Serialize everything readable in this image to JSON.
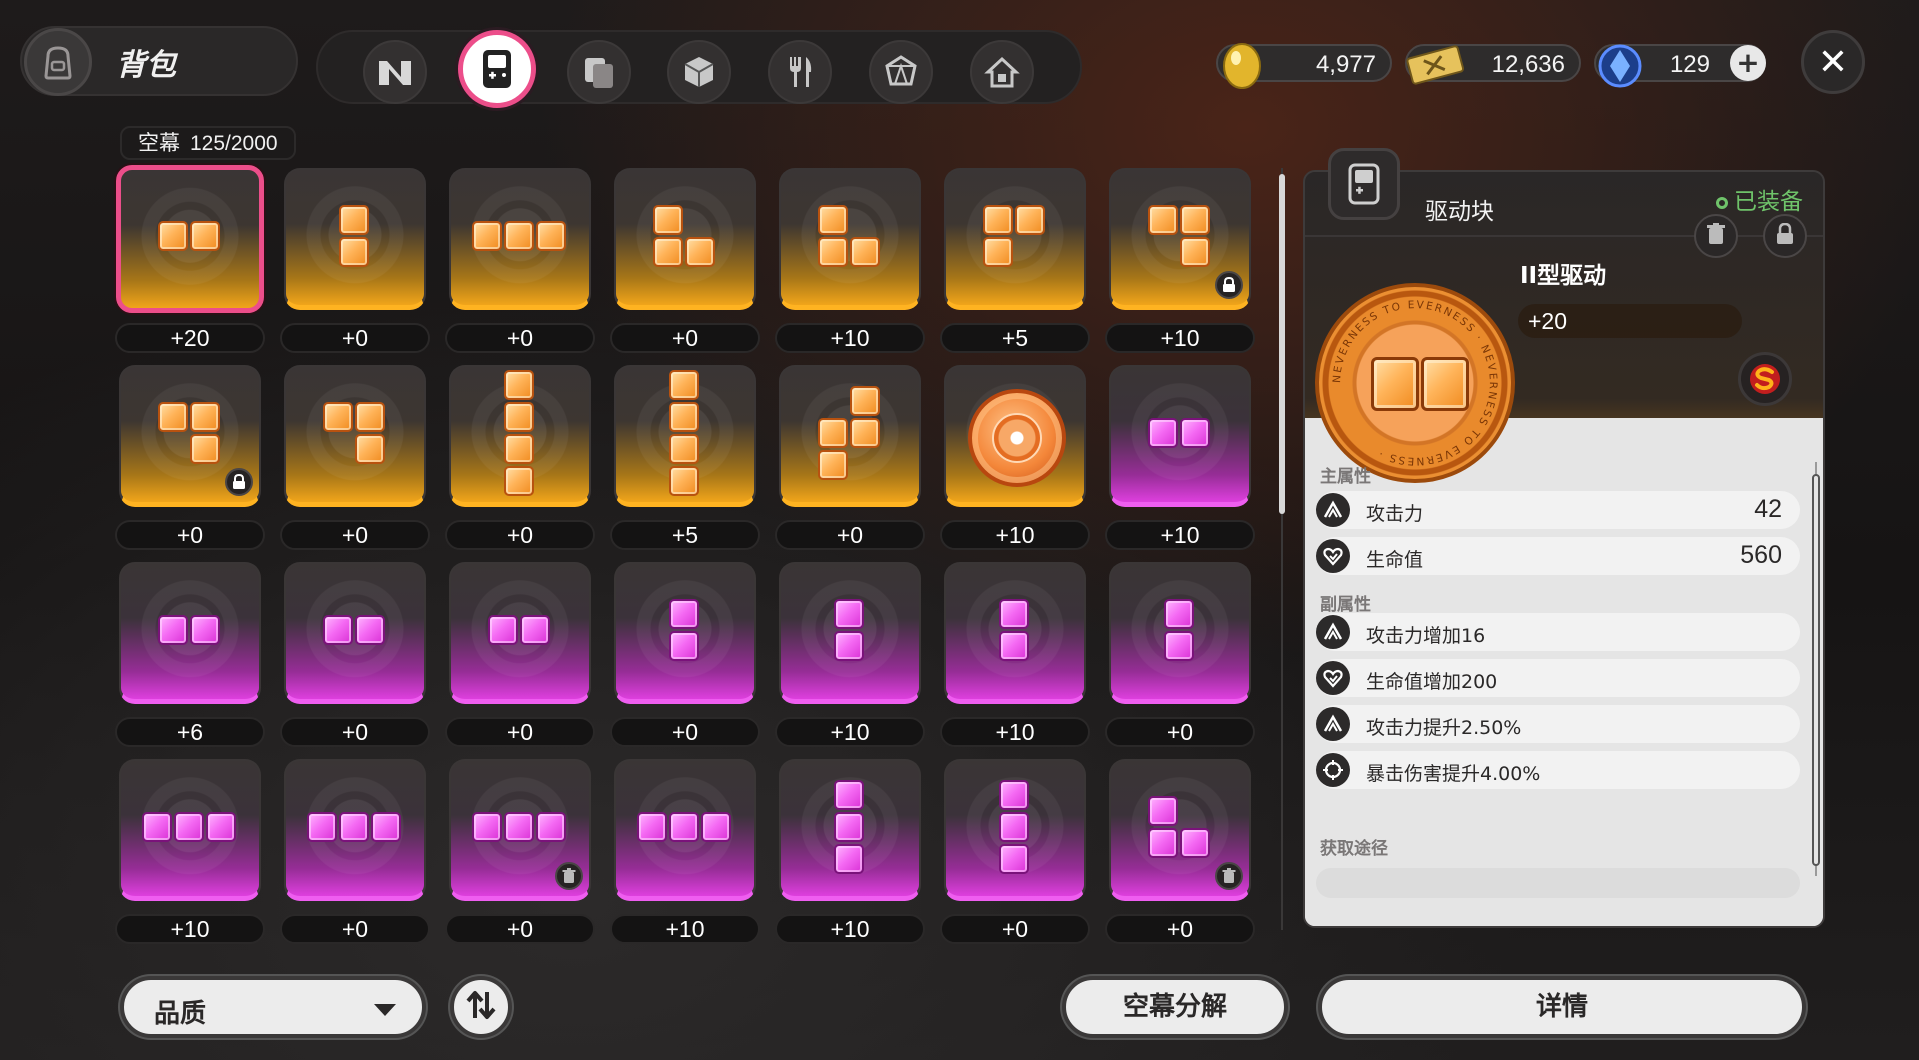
{
  "header": {
    "title": "背包",
    "tabs": [
      {
        "icon": "n-logo-icon",
        "active": false
      },
      {
        "icon": "handheld-console-icon",
        "active": true
      },
      {
        "icon": "stacked-cards-icon",
        "active": false
      },
      {
        "icon": "cube-icon",
        "active": false
      },
      {
        "icon": "fork-knife-icon",
        "active": false
      },
      {
        "icon": "crystal-box-icon",
        "active": false
      },
      {
        "icon": "house-icon",
        "active": false
      }
    ],
    "currencies": [
      {
        "icon": "gold-egg-icon",
        "value": "4,977"
      },
      {
        "icon": "ticket-icon",
        "value": "12,636"
      },
      {
        "icon": "blue-crystal-icon",
        "value": "129"
      }
    ],
    "add_label": "+",
    "close_label": "✕"
  },
  "inventory": {
    "label": "空幕",
    "count": "125/2000",
    "items": [
      {
        "color": "orange",
        "shape": "h2",
        "level": "+20",
        "selected": true,
        "badge": ""
      },
      {
        "color": "orange",
        "shape": "v2",
        "level": "+0",
        "badge": ""
      },
      {
        "color": "orange",
        "shape": "h3",
        "level": "+0",
        "badge": ""
      },
      {
        "color": "orange",
        "shape": "L",
        "level": "+0",
        "badge": ""
      },
      {
        "color": "orange",
        "shape": "L",
        "level": "+10",
        "badge": ""
      },
      {
        "color": "orange",
        "shape": "Gamma",
        "level": "+5",
        "badge": ""
      },
      {
        "color": "orange",
        "shape": "J7",
        "level": "+10",
        "badge": "lock"
      },
      {
        "color": "orange",
        "shape": "J7",
        "level": "+0",
        "badge": "lock"
      },
      {
        "color": "orange",
        "shape": "J7",
        "level": "+0",
        "badge": ""
      },
      {
        "color": "orange",
        "shape": "v4",
        "level": "+0",
        "badge": ""
      },
      {
        "color": "orange",
        "shape": "v4",
        "level": "+5",
        "badge": ""
      },
      {
        "color": "orange",
        "shape": "S",
        "level": "+0",
        "badge": ""
      },
      {
        "color": "orange",
        "shape": "coin",
        "level": "+10",
        "badge": ""
      },
      {
        "color": "purple",
        "shape": "h2",
        "level": "+10",
        "badge": ""
      },
      {
        "color": "purple",
        "shape": "h2",
        "level": "+6",
        "badge": ""
      },
      {
        "color": "purple",
        "shape": "h2",
        "level": "+0",
        "badge": ""
      },
      {
        "color": "purple",
        "shape": "h2",
        "level": "+0",
        "badge": ""
      },
      {
        "color": "purple",
        "shape": "v2",
        "level": "+0",
        "badge": ""
      },
      {
        "color": "purple",
        "shape": "v2",
        "level": "+10",
        "badge": ""
      },
      {
        "color": "purple",
        "shape": "v2",
        "level": "+10",
        "badge": ""
      },
      {
        "color": "purple",
        "shape": "v2",
        "level": "+0",
        "badge": ""
      },
      {
        "color": "purple",
        "shape": "h3",
        "level": "+10",
        "badge": ""
      },
      {
        "color": "purple",
        "shape": "h3",
        "level": "+0",
        "badge": ""
      },
      {
        "color": "purple",
        "shape": "h3",
        "level": "+0",
        "badge": "trash"
      },
      {
        "color": "purple",
        "shape": "h3",
        "level": "+10",
        "badge": ""
      },
      {
        "color": "purple",
        "shape": "v3",
        "level": "+10",
        "badge": ""
      },
      {
        "color": "purple",
        "shape": "v3",
        "level": "+0",
        "badge": ""
      },
      {
        "color": "purple",
        "shape": "L",
        "level": "+0",
        "badge": "trash"
      }
    ]
  },
  "detail": {
    "category": "驱动块",
    "equipped": "已装备",
    "name": "II型驱动",
    "level": "+20",
    "coin_text": "NEVERNESS TO EVERNESS",
    "main_title": "主属性",
    "main_stats": [
      {
        "icon": "attack-icon",
        "name": "攻击力",
        "value": "42"
      },
      {
        "icon": "heart-icon",
        "name": "生命值",
        "value": "560"
      }
    ],
    "sub_title": "副属性",
    "sub_stats": [
      {
        "icon": "attack-icon",
        "name": "攻击力增加16"
      },
      {
        "icon": "heart-icon",
        "name": "生命值增加200"
      },
      {
        "icon": "attack-icon",
        "name": "攻击力提升2.50%"
      },
      {
        "icon": "crit-icon",
        "name": "暴击伤害提升4.00%"
      }
    ],
    "source_title": "获取途径"
  },
  "footer": {
    "sort_label": "品质",
    "decompose_label": "空幕分解",
    "details_label": "详情"
  },
  "colors": {
    "accent": "#ec4e8a",
    "orange": "#f1a51a",
    "purple": "#de3fde",
    "equipped": "#6fc36a"
  }
}
